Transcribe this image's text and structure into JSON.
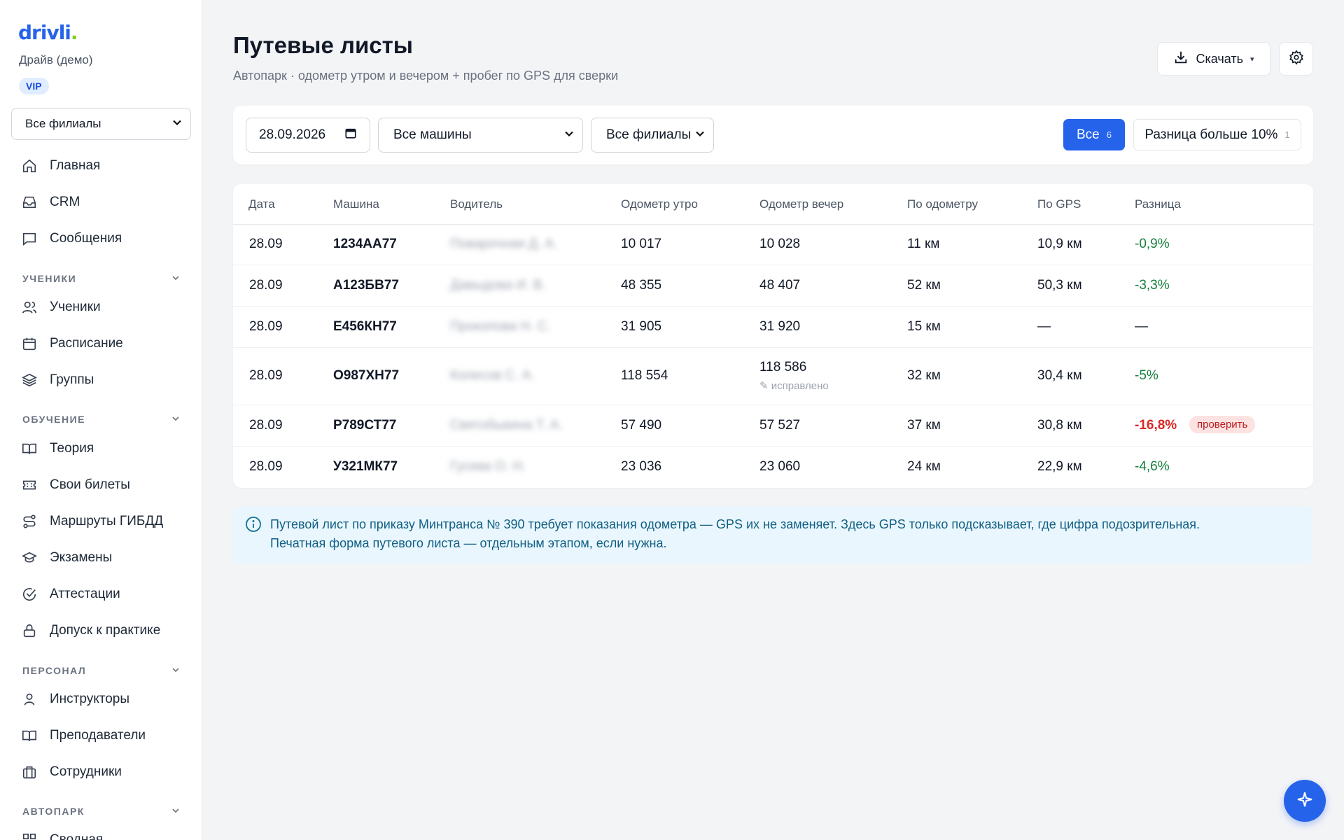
{
  "brand": {
    "logo_text": "drivli",
    "logo_dot": ".",
    "org_name": "Драйв (демо)",
    "plan_badge": "VIP",
    "accent": "#2563eb",
    "logo_dot_color": "#84cc16"
  },
  "sidebar": {
    "branch_select": {
      "value": "Все филиалы",
      "icon": "chevron-down-icon"
    },
    "top_items": [
      {
        "label": "Главная",
        "icon": "home-icon"
      },
      {
        "label": "CRM",
        "icon": "inbox-icon"
      },
      {
        "label": "Сообщения",
        "icon": "message-icon"
      }
    ],
    "sections": [
      {
        "title": "УЧЕНИКИ",
        "items": [
          {
            "label": "Ученики",
            "icon": "users-icon"
          },
          {
            "label": "Расписание",
            "icon": "calendar-icon"
          },
          {
            "label": "Группы",
            "icon": "layers-icon"
          }
        ]
      },
      {
        "title": "ОБУЧЕНИЕ",
        "items": [
          {
            "label": "Теория",
            "icon": "book-open-icon"
          },
          {
            "label": "Свои билеты",
            "icon": "ticket-icon"
          },
          {
            "label": "Маршруты ГИБДД",
            "icon": "route-icon"
          },
          {
            "label": "Экзамены",
            "icon": "graduation-cap-icon"
          },
          {
            "label": "Аттестации",
            "icon": "check-circle-icon"
          },
          {
            "label": "Допуск к практике",
            "icon": "lock-icon"
          }
        ]
      },
      {
        "title": "ПЕРСОНАЛ",
        "items": [
          {
            "label": "Инструкторы",
            "icon": "user-icon"
          },
          {
            "label": "Преподаватели",
            "icon": "book-icon"
          },
          {
            "label": "Сотрудники",
            "icon": "briefcase-icon"
          }
        ]
      },
      {
        "title": "АВТОПАРК",
        "items": [
          {
            "label": "Сводная",
            "icon": "grid-icon"
          }
        ]
      }
    ]
  },
  "header": {
    "title": "Путевые листы",
    "subtitle": "Автопарк · одометр утром и вечером + пробег по GPS для сверки",
    "download_label": "Скачать",
    "download_caret": "▾"
  },
  "filters": {
    "date": "28.09.2026",
    "car_select": "Все машины",
    "branch_select": "Все филиалы",
    "segments": [
      {
        "label": "Все",
        "count": "6",
        "active": true
      },
      {
        "label": "Разница больше 10%",
        "count": "1",
        "active": false
      }
    ]
  },
  "table": {
    "columns": [
      "Дата",
      "Машина",
      "Водитель",
      "Одометр утро",
      "Одометр вечер",
      "По одометру",
      "По GPS",
      "Разница"
    ],
    "rows": [
      {
        "date": "28.09",
        "car": "1234АА77",
        "driver": "Поварочная Д. А.",
        "odo_am": "10 017",
        "odo_pm": "10 028",
        "by_odo": "11 км",
        "by_gps": "10,9 км",
        "diff": "-0,9%",
        "diff_status": "ok"
      },
      {
        "date": "28.09",
        "car": "А123БВ77",
        "driver": "Давыдова И. В.",
        "odo_am": "48 355",
        "odo_pm": "48 407",
        "by_odo": "52 км",
        "by_gps": "50,3 км",
        "diff": "-3,3%",
        "diff_status": "ok"
      },
      {
        "date": "28.09",
        "car": "Е456КН77",
        "driver": "Прокопова Н. С.",
        "odo_am": "31 905",
        "odo_pm": "31 920",
        "by_odo": "15 км",
        "by_gps": "—",
        "diff": "—",
        "diff_status": "none"
      },
      {
        "date": "28.09",
        "car": "О987ХН77",
        "driver": "Колесов С. А.",
        "odo_am": "118 554",
        "odo_pm": "118 586",
        "odo_pm_note": "✎ исправлено",
        "by_odo": "32 км",
        "by_gps": "30,4 км",
        "diff": "-5%",
        "diff_status": "ok"
      },
      {
        "date": "28.09",
        "car": "Р789СТ77",
        "driver": "Святобыкина Т. А.",
        "odo_am": "57 490",
        "odo_pm": "57 527",
        "by_odo": "37 км",
        "by_gps": "30,8 км",
        "diff": "-16,8%",
        "diff_status": "bad",
        "badge": "проверить"
      },
      {
        "date": "28.09",
        "car": "У321МК77",
        "driver": "Гусева О. Н.",
        "odo_am": "23 036",
        "odo_pm": "23 060",
        "by_odo": "24 км",
        "by_gps": "22,9 км",
        "diff": "-4,6%",
        "diff_status": "ok"
      }
    ]
  },
  "info": {
    "icon": "info-icon",
    "line1": "Путевой лист по приказу Минтранса № 390 требует показания одометра — GPS их не заменяет. Здесь GPS только подсказывает, где цифра подозрительная.",
    "line2": "Печатная форма путевого листа — отдельным этапом, если нужна."
  },
  "fab": {
    "icon": "sparkle-icon"
  }
}
